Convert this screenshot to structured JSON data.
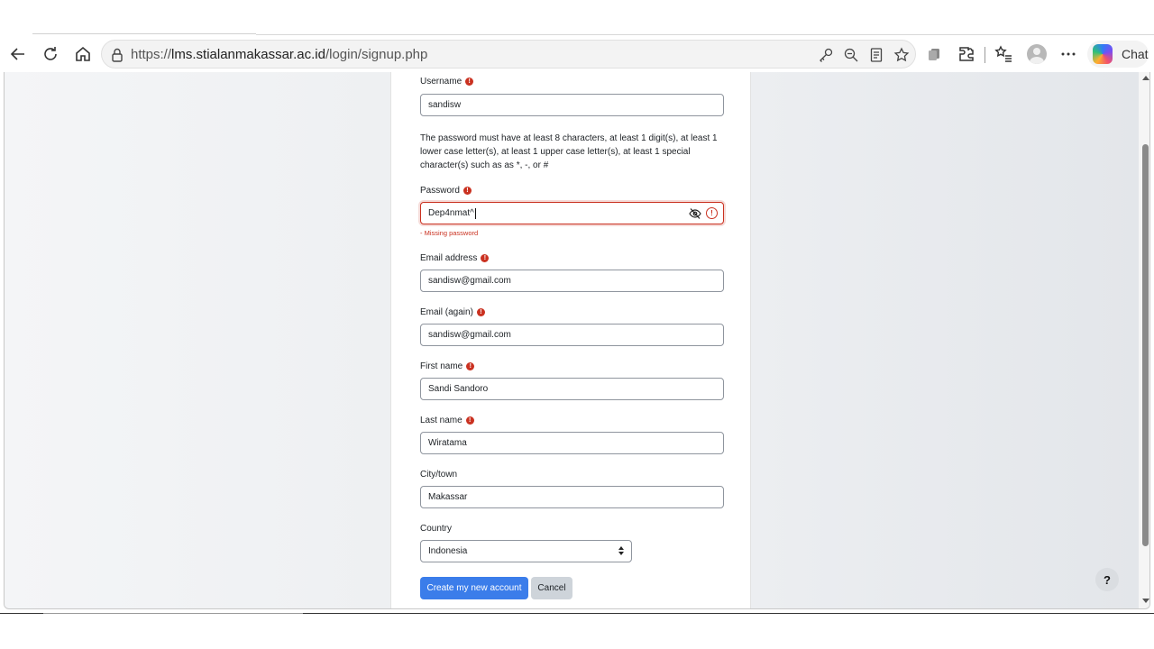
{
  "browser": {
    "url_prefix": "https://",
    "url_domain": "lms.stialanmakassar.ac.id",
    "url_path": "/login/signup.php",
    "chat_label": "Chat"
  },
  "form": {
    "username": {
      "label": "Username",
      "value": "sandisw"
    },
    "password_policy": "The password must have at least 8 characters, at least 1 digit(s), at least 1 lower case letter(s), at least 1 upper case letter(s), at least 1 special character(s) such as as *, -, or #",
    "password": {
      "label": "Password",
      "value": "Dep4nmat^",
      "error": "- Missing password"
    },
    "email": {
      "label": "Email address",
      "value": "sandisw@gmail.com"
    },
    "email_again": {
      "label": "Email (again)",
      "value": "sandisw@gmail.com"
    },
    "first_name": {
      "label": "First name",
      "value": "Sandi Sandoro"
    },
    "last_name": {
      "label": "Last name",
      "value": "Wiratama"
    },
    "city": {
      "label": "City/town",
      "value": "Makassar"
    },
    "country": {
      "label": "Country",
      "value": "Indonesia"
    },
    "submit_label": "Create my new account",
    "cancel_label": "Cancel"
  },
  "required_icon_glyph": "!",
  "help_label": "?",
  "colors": {
    "primary": "#3b7dea",
    "error": "#ca3120"
  }
}
